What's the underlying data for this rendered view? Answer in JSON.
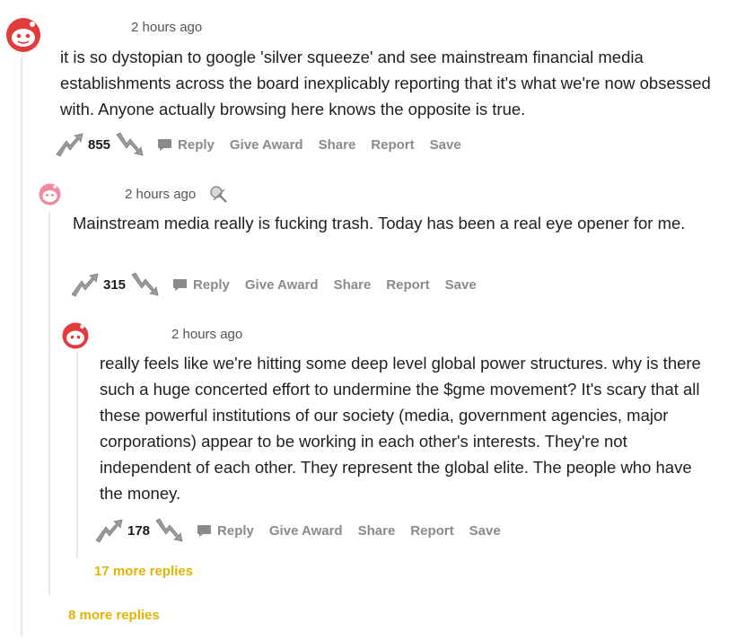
{
  "comments": [
    {
      "timestamp": "2 hours ago",
      "body": "it is so dystopian to google 'silver squeeze' and see mainstream financial media establishments across the board inexplicably reporting that it's what we're now obsessed with. Anyone actually browsing here knows the opposite is true.",
      "score": "855",
      "actions": {
        "reply": "Reply",
        "give_award": "Give Award",
        "share": "Share",
        "report": "Report",
        "save": "Save"
      },
      "more_replies": "8 more replies"
    },
    {
      "timestamp": "2 hours ago",
      "body": "Mainstream media really is fucking trash. Today has been a real eye opener for me.",
      "score": "315",
      "actions": {
        "reply": "Reply",
        "give_award": "Give Award",
        "share": "Share",
        "report": "Report",
        "save": "Save"
      },
      "more_replies": "17 more replies"
    },
    {
      "timestamp": "2 hours ago",
      "body": "really feels like we're hitting some deep level global power structures. why is there such a huge concerted effort to undermine the $gme movement? It's scary that all these powerful institutions of our society (media, government agencies, major corporations) appear to be working in each other's interests. They're not independent of each other. They represent the global elite. The people who have the money.",
      "score": "178",
      "actions": {
        "reply": "Reply",
        "give_award": "Give Award",
        "share": "Share",
        "report": "Report",
        "save": "Save"
      }
    }
  ],
  "colors": {
    "accent": "#e0b400",
    "muted": "#8a8a8a",
    "avatar_red": "#e23b3b",
    "avatar_pink": "#f08aa0"
  }
}
